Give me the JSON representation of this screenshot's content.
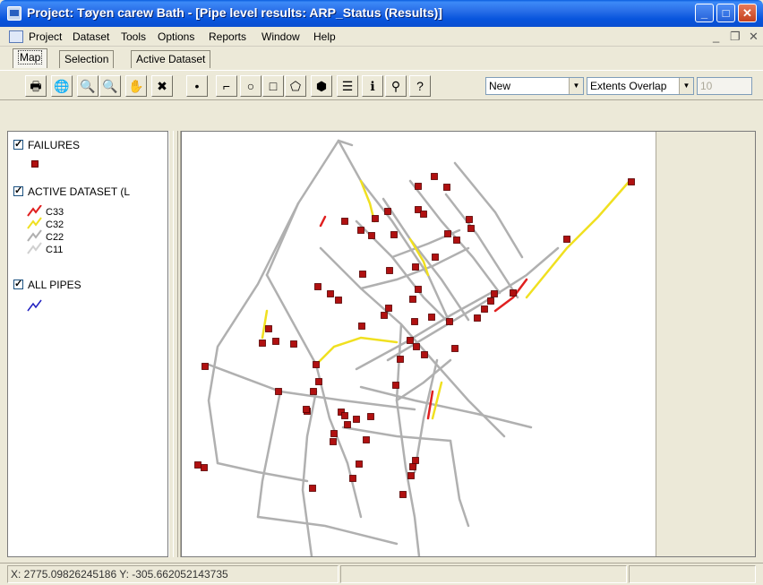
{
  "window": {
    "title": "Project: Tøyen carew Bath - [Pipe level results: ARP_Status (Results)]",
    "min": "_",
    "max": "□",
    "close": "✕"
  },
  "menu": {
    "items": [
      "Project",
      "Dataset",
      "Tools",
      "Options",
      "Reports",
      "Window",
      "Help"
    ],
    "mdi_min": "_",
    "mdi_restore": "❐",
    "mdi_close": "✕"
  },
  "tabs": [
    "Map",
    "Selection",
    "Active Dataset"
  ],
  "toolbar": {
    "tools": [
      "print-icon",
      "globe-icon",
      "zoom-in-icon",
      "zoom-out-icon",
      "pan-hand-icon",
      "clear-selection-icon",
      "point-icon",
      "polyline-icon",
      "circle-icon",
      "rectangle-icon",
      "polygon-icon",
      "select-icon",
      "layers-icon",
      "info-icon",
      "find-icon",
      "help-icon"
    ],
    "glyphs": [
      "🖶",
      "🌐",
      "🔍",
      "🔍",
      "✋",
      "✖",
      "•",
      "⌐",
      "○",
      "□",
      "⬠",
      "⬢",
      "☰",
      "ℹ",
      "⚲",
      "?"
    ],
    "mode_select": "New",
    "overlap_select": "Extents Overlap",
    "count_field": "10"
  },
  "legend": {
    "groups": [
      {
        "label": "FAILURES"
      },
      {
        "label": "ACTIVE DATASET (L"
      },
      {
        "label": "ALL PIPES"
      }
    ],
    "classes": [
      "C33",
      "C32",
      "C22",
      "C11"
    ],
    "colors": {
      "failure": "#b01010",
      "c33": "#e02020",
      "c32": "#f0e020",
      "c22": "#b0b0b0",
      "c11": "#d0d0d0",
      "all_pipes": "#2020c0"
    }
  },
  "status": {
    "coords": "X: 2775.09826245186 Y: -305.662052143735"
  },
  "map": {
    "pipes_grey": [
      [
        [
          175,
          10
        ],
        [
          200,
          55
        ]
      ],
      [
        [
          130,
          80
        ],
        [
          175,
          10
        ]
      ],
      [
        [
          175,
          10
        ],
        [
          190,
          15
        ]
      ],
      [
        [
          130,
          80
        ],
        [
          85,
          170
        ],
        [
          40,
          240
        ],
        [
          30,
          300
        ],
        [
          40,
          370
        ]
      ],
      [
        [
          130,
          80
        ],
        [
          95,
          160
        ]
      ],
      [
        [
          95,
          160
        ],
        [
          150,
          260
        ]
      ],
      [
        [
          200,
          55
        ],
        [
          235,
          100
        ],
        [
          275,
          160
        ],
        [
          300,
          215
        ]
      ],
      [
        [
          295,
          70
        ],
        [
          330,
          115
        ],
        [
          375,
          185
        ]
      ],
      [
        [
          155,
          130
        ],
        [
          200,
          175
        ],
        [
          245,
          215
        ],
        [
          280,
          255
        ],
        [
          320,
          300
        ],
        [
          360,
          340
        ]
      ],
      [
        [
          195,
          100
        ],
        [
          235,
          140
        ],
        [
          270,
          185
        ],
        [
          300,
          215
        ]
      ],
      [
        [
          225,
          75
        ],
        [
          255,
          120
        ],
        [
          290,
          165
        ],
        [
          320,
          210
        ]
      ],
      [
        [
          255,
          55
        ],
        [
          290,
          100
        ],
        [
          325,
          140
        ],
        [
          355,
          180
        ]
      ],
      [
        [
          305,
          35
        ],
        [
          350,
          90
        ],
        [
          380,
          140
        ]
      ],
      [
        [
          230,
          255
        ],
        [
          280,
          225
        ],
        [
          330,
          195
        ],
        [
          385,
          160
        ],
        [
          420,
          130
        ]
      ],
      [
        [
          195,
          265
        ],
        [
          250,
          235
        ],
        [
          300,
          205
        ],
        [
          345,
          180
        ]
      ],
      [
        [
          200,
          285
        ],
        [
          260,
          300
        ],
        [
          330,
          315
        ],
        [
          390,
          330
        ]
      ],
      [
        [
          30,
          260
        ],
        [
          110,
          290
        ],
        [
          180,
          300
        ],
        [
          260,
          310
        ]
      ],
      [
        [
          150,
          260
        ],
        [
          165,
          320
        ],
        [
          185,
          370
        ],
        [
          200,
          430
        ]
      ],
      [
        [
          245,
          215
        ],
        [
          240,
          300
        ],
        [
          250,
          375
        ],
        [
          260,
          430
        ],
        [
          265,
          474
        ]
      ],
      [
        [
          285,
          255
        ],
        [
          270,
          320
        ],
        [
          260,
          380
        ]
      ],
      [
        [
          150,
          290
        ],
        [
          140,
          340
        ],
        [
          135,
          400
        ],
        [
          145,
          474
        ]
      ],
      [
        [
          110,
          290
        ],
        [
          100,
          340
        ],
        [
          90,
          390
        ],
        [
          85,
          430
        ]
      ],
      [
        [
          85,
          430
        ],
        [
          160,
          440
        ],
        [
          240,
          460
        ]
      ],
      [
        [
          180,
          330
        ],
        [
          240,
          340
        ],
        [
          300,
          345
        ]
      ],
      [
        [
          40,
          370
        ],
        [
          85,
          380
        ],
        [
          140,
          390
        ]
      ],
      [
        [
          300,
          345
        ],
        [
          310,
          410
        ],
        [
          320,
          440
        ]
      ],
      [
        [
          240,
          300
        ],
        [
          270,
          280
        ],
        [
          300,
          255
        ]
      ],
      [
        [
          200,
          175
        ],
        [
          240,
          165
        ],
        [
          280,
          150
        ],
        [
          320,
          130
        ]
      ],
      [
        [
          235,
          140
        ],
        [
          275,
          125
        ],
        [
          310,
          110
        ]
      ]
    ],
    "pipes_yellow": [
      [
        [
          200,
          55
        ],
        [
          210,
          80
        ],
        [
          215,
          100
        ]
      ],
      [
        [
          385,
          185
        ],
        [
          430,
          130
        ],
        [
          465,
          95
        ],
        [
          500,
          55
        ]
      ],
      [
        [
          255,
          120
        ],
        [
          270,
          145
        ],
        [
          275,
          160
        ]
      ],
      [
        [
          150,
          260
        ],
        [
          170,
          240
        ],
        [
          200,
          230
        ],
        [
          240,
          235
        ]
      ],
      [
        [
          290,
          280
        ],
        [
          285,
          300
        ],
        [
          280,
          320
        ]
      ],
      [
        [
          95,
          200
        ],
        [
          90,
          230
        ]
      ]
    ],
    "pipes_red": [
      [
        [
          350,
          200
        ],
        [
          370,
          185
        ],
        [
          385,
          165
        ]
      ],
      [
        [
          160,
          95
        ],
        [
          155,
          105
        ]
      ],
      [
        [
          280,
          290
        ],
        [
          275,
          320
        ]
      ]
    ],
    "failures": [
      [
        282,
        50
      ],
      [
        296,
        62
      ],
      [
        264,
        61
      ],
      [
        264,
        87
      ],
      [
        230,
        89
      ],
      [
        216,
        97
      ],
      [
        200,
        110
      ],
      [
        182,
        100
      ],
      [
        212,
        116
      ],
      [
        237,
        115
      ],
      [
        270,
        92
      ],
      [
        297,
        114
      ],
      [
        321,
        98
      ],
      [
        323,
        108
      ],
      [
        307,
        121
      ],
      [
        283,
        140
      ],
      [
        261,
        151
      ],
      [
        232,
        155
      ],
      [
        202,
        159
      ],
      [
        152,
        173
      ],
      [
        166,
        181
      ],
      [
        175,
        188
      ],
      [
        264,
        176
      ],
      [
        258,
        187
      ],
      [
        231,
        197
      ],
      [
        201,
        217
      ],
      [
        226,
        205
      ],
      [
        260,
        212
      ],
      [
        279,
        207
      ],
      [
        255,
        233
      ],
      [
        262,
        240
      ],
      [
        271,
        249
      ],
      [
        244,
        254
      ],
      [
        239,
        283
      ],
      [
        305,
        242
      ],
      [
        299,
        212
      ],
      [
        330,
        208
      ],
      [
        338,
        198
      ],
      [
        345,
        189
      ],
      [
        349,
        181
      ],
      [
        370,
        180
      ],
      [
        430,
        120
      ],
      [
        502,
        56
      ],
      [
        97,
        220
      ],
      [
        90,
        236
      ],
      [
        105,
        234
      ],
      [
        125,
        237
      ],
      [
        26,
        262
      ],
      [
        108,
        290
      ],
      [
        150,
        260
      ],
      [
        153,
        279
      ],
      [
        147,
        290
      ],
      [
        140,
        312
      ],
      [
        178,
        313
      ],
      [
        182,
        317
      ],
      [
        185,
        327
      ],
      [
        195,
        321
      ],
      [
        211,
        318
      ],
      [
        206,
        344
      ],
      [
        170,
        337
      ],
      [
        169,
        346
      ],
      [
        198,
        371
      ],
      [
        191,
        387
      ],
      [
        258,
        374
      ],
      [
        261,
        367
      ],
      [
        256,
        384
      ],
      [
        247,
        405
      ],
      [
        146,
        398
      ],
      [
        18,
        372
      ],
      [
        25,
        375
      ],
      [
        139,
        310
      ]
    ]
  }
}
